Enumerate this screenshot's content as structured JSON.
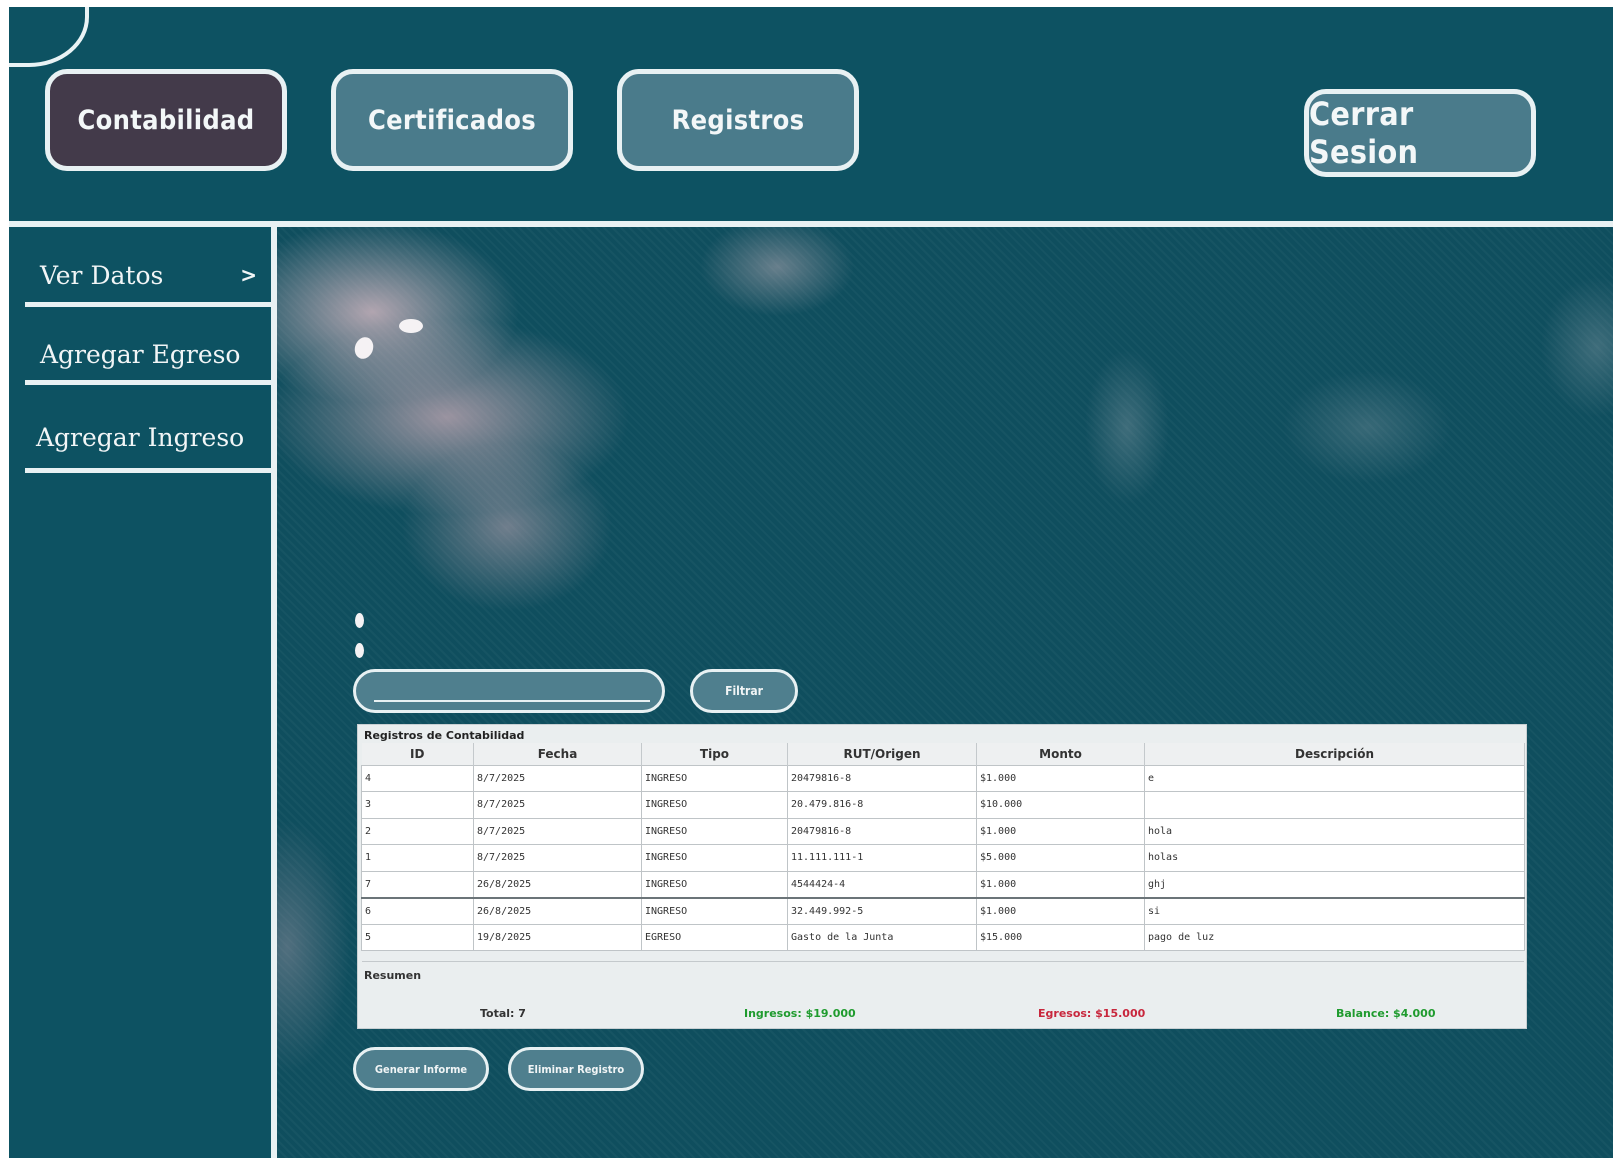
{
  "header": {
    "tabs": [
      {
        "label": "Contabilidad",
        "active": true
      },
      {
        "label": "Certificados",
        "active": false
      },
      {
        "label": "Registros",
        "active": false
      }
    ],
    "logout_label": "Cerrar Sesion"
  },
  "sidebar": {
    "items": [
      {
        "label": "Ver Datos",
        "arrow": ">"
      },
      {
        "label": "Agregar Egreso"
      },
      {
        "label": "Agregar Ingreso"
      }
    ]
  },
  "filter": {
    "value": "",
    "button_label": "Filtrar"
  },
  "panel": {
    "title": "Registros de Contabilidad",
    "columns": [
      "ID",
      "Fecha",
      "Tipo",
      "RUT/Origen",
      "Monto",
      "Descripción"
    ],
    "rows": [
      {
        "id": "4",
        "fecha": "8/7/2025",
        "tipo": "INGRESO",
        "rut": "20479816-8",
        "monto": "$1.000",
        "desc": "e"
      },
      {
        "id": "3",
        "fecha": "8/7/2025",
        "tipo": "INGRESO",
        "rut": "20.479.816-8",
        "monto": "$10.000",
        "desc": ""
      },
      {
        "id": "2",
        "fecha": "8/7/2025",
        "tipo": "INGRESO",
        "rut": "20479816-8",
        "monto": "$1.000",
        "desc": "hola"
      },
      {
        "id": "1",
        "fecha": "8/7/2025",
        "tipo": "INGRESO",
        "rut": "11.111.111-1",
        "monto": "$5.000",
        "desc": "holas"
      },
      {
        "id": "7",
        "fecha": "26/8/2025",
        "tipo": "INGRESO",
        "rut": "4544424-4",
        "monto": "$1.000",
        "desc": "ghj"
      },
      {
        "id": "6",
        "fecha": "26/8/2025",
        "tipo": "INGRESO",
        "rut": "32.449.992-5",
        "monto": "$1.000",
        "desc": "si"
      },
      {
        "id": "5",
        "fecha": "19/8/2025",
        "tipo": "EGRESO",
        "rut": "Gasto de la Junta",
        "monto": "$15.000",
        "desc": "pago de luz"
      }
    ],
    "summary": {
      "title": "Resumen",
      "total": "Total: 7",
      "ingresos": "Ingresos: $19.000",
      "egresos": "Egresos: $15.000",
      "balance": "Balance: $4.000"
    }
  },
  "actions": {
    "generate_label": "Generar Informe",
    "delete_label": "Eliminar Registro"
  },
  "colors": {
    "background": "#0d5262",
    "tab_active": "#433a4a",
    "tab_inactive": "#4a7b8b",
    "ingresos": "#1f9b2e",
    "egresos": "#c8263c"
  }
}
